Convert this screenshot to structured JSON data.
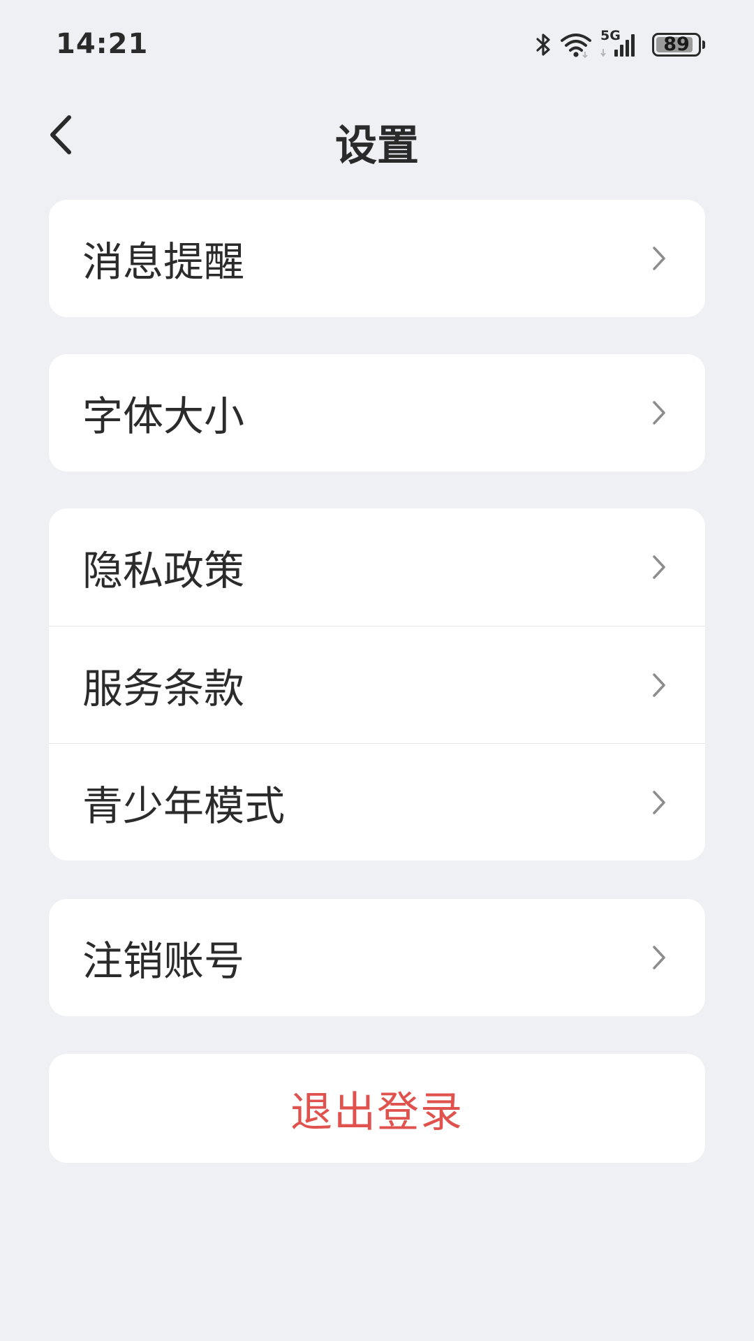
{
  "status_bar": {
    "time": "14:21",
    "network_label": "5G",
    "battery_level": "89",
    "battery_fraction": 0.89,
    "icons": [
      "bluetooth-icon",
      "wifi-icon",
      "cellular-signal-icon",
      "battery-icon"
    ]
  },
  "header": {
    "title": "设置",
    "back_icon": "chevron-left-icon"
  },
  "groups": [
    {
      "items": [
        {
          "label": "消息提醒"
        }
      ]
    },
    {
      "items": [
        {
          "label": "字体大小"
        }
      ]
    },
    {
      "items": [
        {
          "label": "隐私政策"
        },
        {
          "label": "服务条款"
        },
        {
          "label": "青少年模式"
        }
      ]
    },
    {
      "items": [
        {
          "label": "注销账号"
        }
      ]
    }
  ],
  "logout": {
    "label": "退出登录",
    "color": "#e0524d"
  },
  "colors": {
    "background": "#eff0f4",
    "card": "#ffffff",
    "text": "#2b2b2b",
    "chevron": "#8c8c8c",
    "danger": "#e0524d"
  }
}
